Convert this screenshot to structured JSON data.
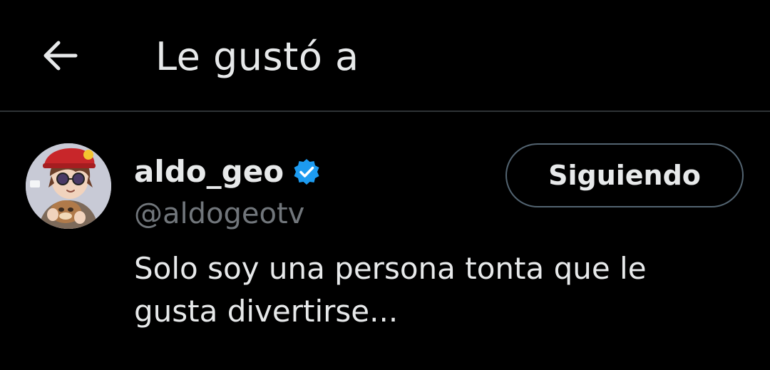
{
  "header": {
    "title": "Le gustó a",
    "back_icon": "arrow-left-icon"
  },
  "user": {
    "display_name": "aldo_geo",
    "handle": "@aldogeotv",
    "verified": true,
    "verified_icon": "verified-badge-icon",
    "verified_color": "#1d9bf0",
    "bio": "Solo soy una persona tonta que le gusta divertirse...",
    "follow_button_label": "Siguiendo",
    "avatar_icon": "avatar-image"
  },
  "colors": {
    "background": "#000000",
    "primary_text": "#e7e9ea",
    "secondary_text": "#71767b",
    "divider": "#2f3336",
    "button_border": "#536471"
  }
}
